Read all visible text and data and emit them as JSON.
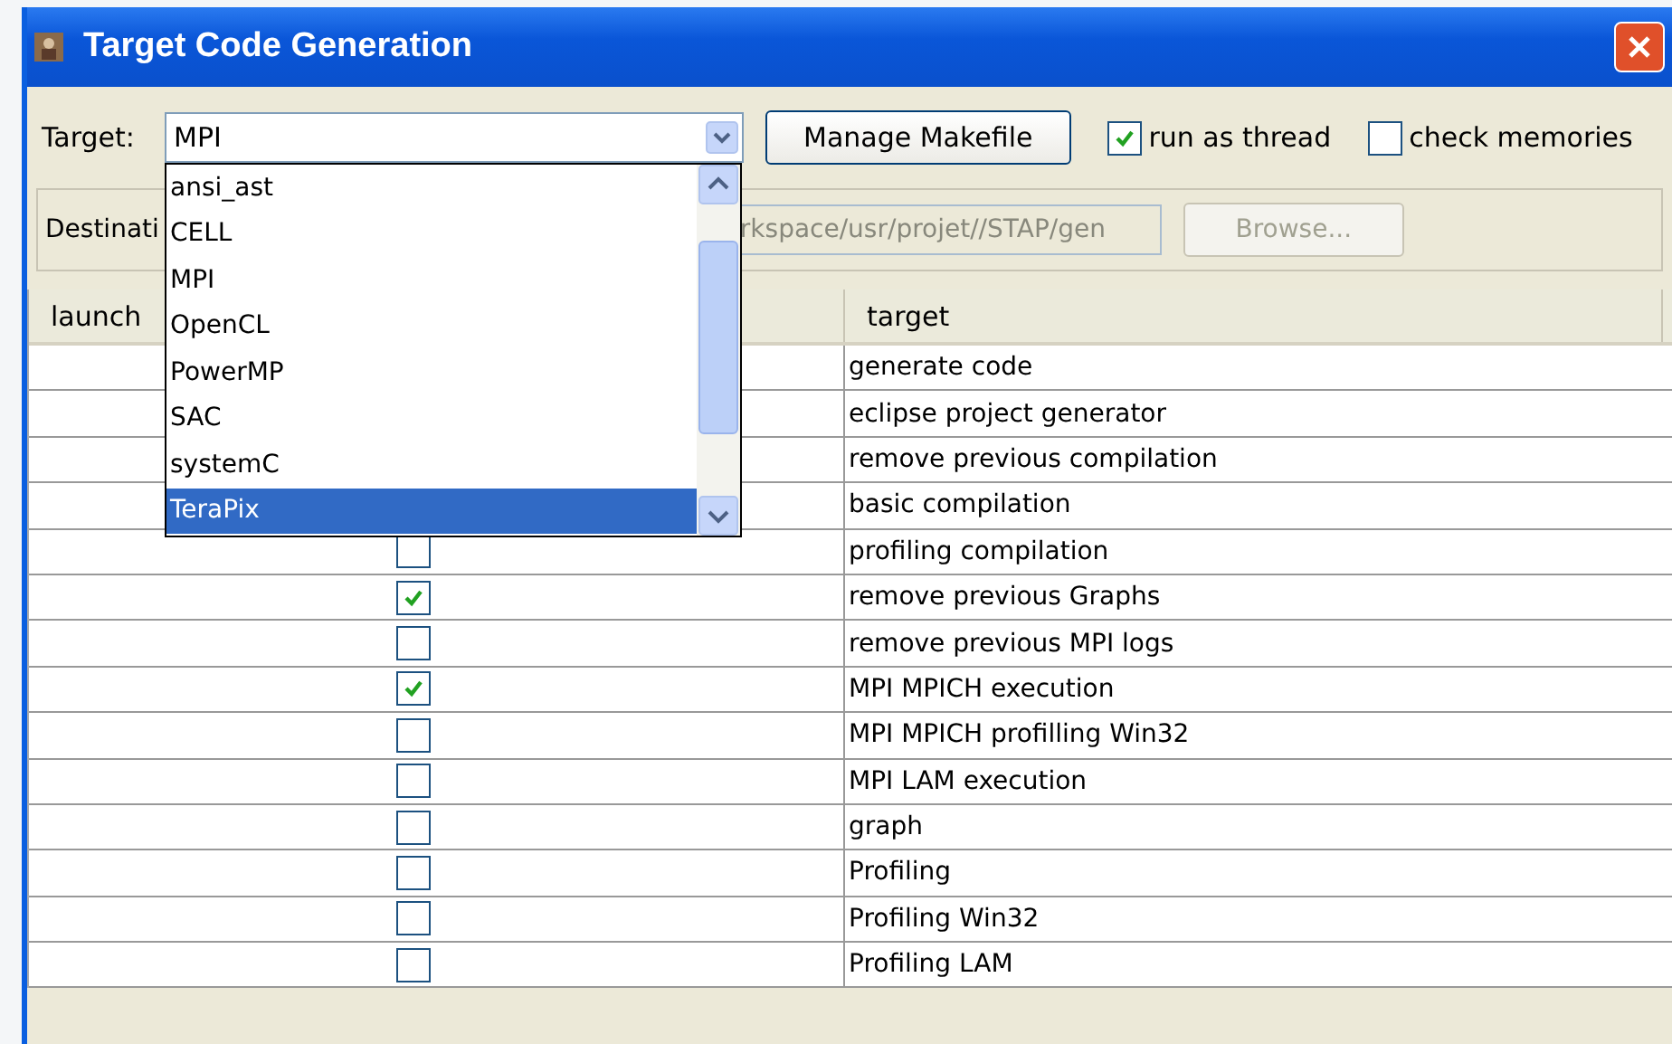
{
  "window": {
    "title": "Target Code Generation"
  },
  "toolbar": {
    "target_label": "Target:",
    "target_value": "MPI",
    "manage_button": "Manage Makefile",
    "options": [
      {
        "label": "run as thread",
        "checked": true
      },
      {
        "label": "check memories",
        "checked": false
      }
    ]
  },
  "destination": {
    "label": "Destinati",
    "path": "rkspace/usr/projet//STAP/gen",
    "browse": "Browse...",
    "disabled": true
  },
  "dropdown": {
    "items": [
      {
        "label": "ansi_ast",
        "selected": false
      },
      {
        "label": "CELL",
        "selected": false
      },
      {
        "label": "MPI",
        "selected": false
      },
      {
        "label": "OpenCL",
        "selected": false
      },
      {
        "label": "PowerMP",
        "selected": false
      },
      {
        "label": "SAC",
        "selected": false
      },
      {
        "label": "systemC",
        "selected": false
      },
      {
        "label": "TeraPix",
        "selected": true
      }
    ]
  },
  "table": {
    "columns": [
      "launch",
      "target"
    ],
    "rows": [
      {
        "target": "generate code"
      },
      {
        "target": "eclipse project generator"
      },
      {
        "target": "remove previous compilation"
      },
      {
        "target": "basic compilation"
      },
      {
        "target": "profiling compilation",
        "checked": false
      },
      {
        "target": "remove previous Graphs",
        "checked": true
      },
      {
        "target": "remove previous MPI logs",
        "checked": false
      },
      {
        "target": "MPI MPICH execution",
        "checked": true
      },
      {
        "target": "MPI MPICH profilling Win32",
        "checked": false
      },
      {
        "target": "MPI LAM execution",
        "checked": false
      },
      {
        "target": "graph",
        "checked": false
      },
      {
        "target": "Profiling",
        "checked": false
      },
      {
        "target": "Profiling Win32",
        "checked": false
      },
      {
        "target": "Profiling LAM",
        "checked": false
      }
    ]
  }
}
